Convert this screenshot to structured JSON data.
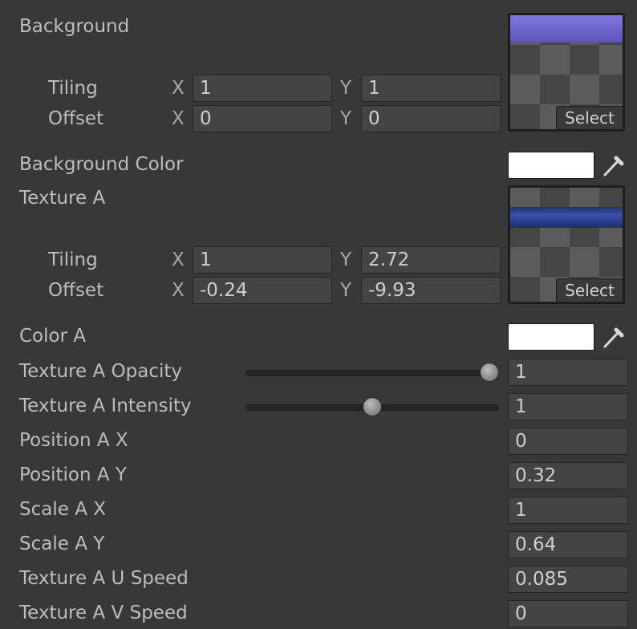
{
  "background": {
    "label": "Background",
    "tiling_label": "Tiling",
    "offset_label": "Offset",
    "x_label": "X",
    "y_label": "Y",
    "tiling_x": "1",
    "tiling_y": "1",
    "offset_x": "0",
    "offset_y": "0",
    "select_label": "Select",
    "texture_color": "#6a62c8"
  },
  "background_color": {
    "label": "Background Color",
    "value": "#ffffff",
    "picker_icon": "eyedropper-icon"
  },
  "texture_a": {
    "label": "Texture A",
    "tiling_label": "Tiling",
    "offset_label": "Offset",
    "x_label": "X",
    "y_label": "Y",
    "tiling_x": "1",
    "tiling_y": "2.72",
    "offset_x": "-0.24",
    "offset_y": "-9.93",
    "select_label": "Select",
    "texture_color": "#2c3f8f"
  },
  "color_a": {
    "label": "Color A",
    "value": "#ffffff",
    "picker_icon": "eyedropper-icon"
  },
  "properties": [
    {
      "label": "Texture A Opacity",
      "value": "1",
      "slider": true,
      "slider_fraction": 1.0
    },
    {
      "label": "Texture A Intensity",
      "value": "1",
      "slider": true,
      "slider_fraction": 0.5
    },
    {
      "label": "Position A X",
      "value": "0",
      "slider": false
    },
    {
      "label": "Position A Y",
      "value": "0.32",
      "slider": false
    },
    {
      "label": "Scale A X",
      "value": "1",
      "slider": false
    },
    {
      "label": "Scale A Y",
      "value": "0.64",
      "slider": false
    },
    {
      "label": "Texture A U Speed",
      "value": "0.085",
      "slider": false
    },
    {
      "label": "Texture A V Speed",
      "value": "0",
      "slider": false
    }
  ]
}
